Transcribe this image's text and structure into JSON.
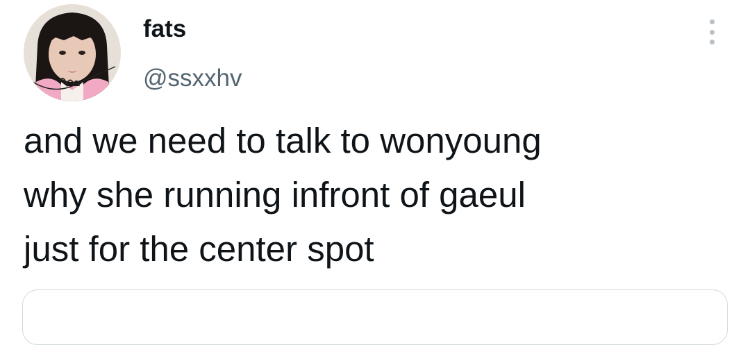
{
  "author": {
    "display_name": "fats",
    "handle": "@ssxxhv",
    "avatar_icon": "user-avatar-photo"
  },
  "tweet": {
    "text": "and we need to talk to wonyoung\nwhy she running infront of gaeul\njust for the center spot"
  },
  "more_icon": "more-vertical-dots-icon",
  "colors": {
    "text_primary": "#0f1419",
    "text_secondary": "#536471",
    "border": "#cfd9de"
  }
}
